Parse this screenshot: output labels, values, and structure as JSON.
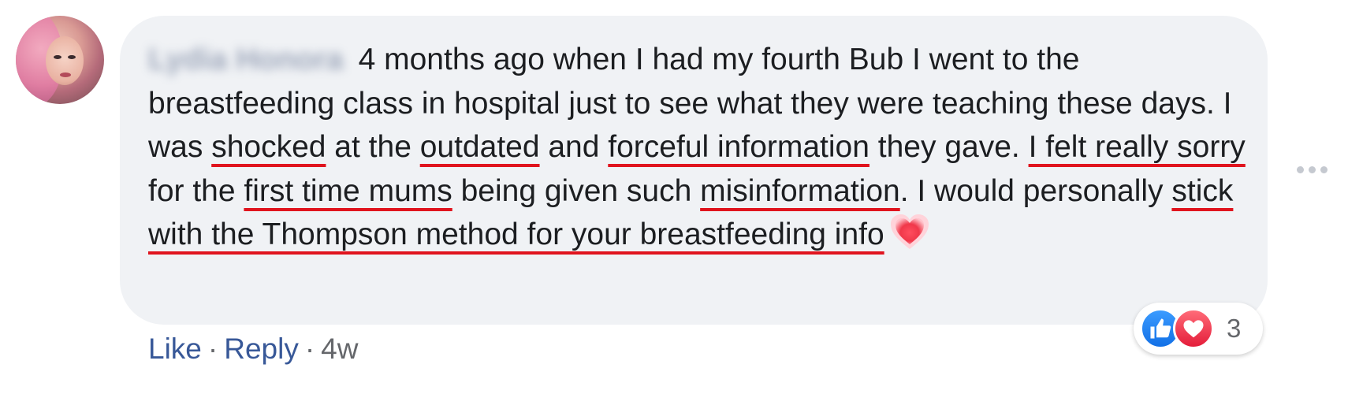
{
  "comment": {
    "author": "Lydia Honora",
    "segments": [
      {
        "text": " 4 months ago when I had my fourth Bub I went to the breastfeeding class in hospital just to see what they were teaching these days. I was ",
        "underline": false
      },
      {
        "text": "shocked",
        "underline": true
      },
      {
        "text": " at the ",
        "underline": false
      },
      {
        "text": "outdated",
        "underline": true
      },
      {
        "text": " and ",
        "underline": false
      },
      {
        "text": "forceful information",
        "underline": true
      },
      {
        "text": " they gave. ",
        "underline": false
      },
      {
        "text": "I felt really sorry",
        "underline": true
      },
      {
        "text": " for the ",
        "underline": false
      },
      {
        "text": "first time mums",
        "underline": true
      },
      {
        "text": " being given such ",
        "underline": false
      },
      {
        "text": "misinformation",
        "underline": true
      },
      {
        "text": ". I would personally ",
        "underline": false
      },
      {
        "text": "stick with the Thompson method for your breastfeeding info",
        "underline": true
      }
    ],
    "emoji": "heart-emoji"
  },
  "actions": {
    "like_label": "Like",
    "reply_label": "Reply",
    "separator": "·",
    "age": "4w"
  },
  "reactions": {
    "icons": [
      "like-icon",
      "love-icon"
    ],
    "count": "3"
  },
  "colors": {
    "bubble": "#f0f2f5",
    "link": "#385898",
    "underline": "#e0141e",
    "like": "#1877f2",
    "love": "#e41d3a"
  }
}
